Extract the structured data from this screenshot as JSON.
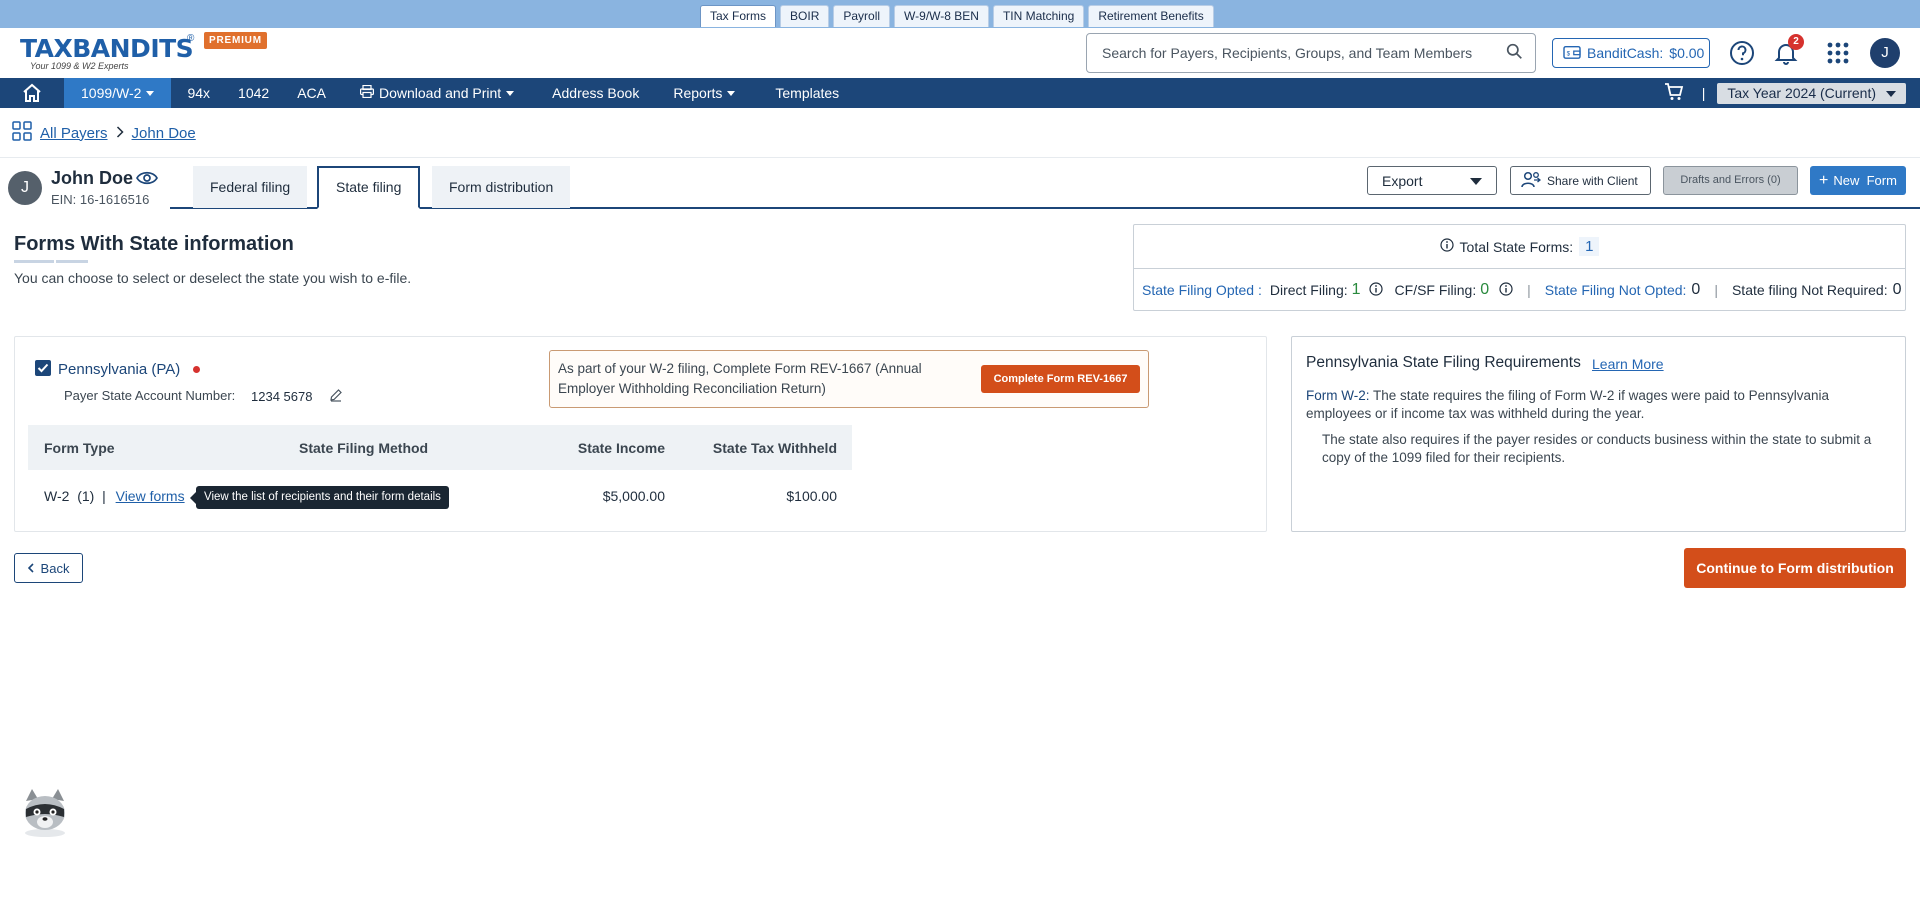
{
  "top_tabs": [
    "Tax Forms",
    "BOIR",
    "Payroll",
    "W-9/W-8 BEN",
    "TIN Matching",
    "Retirement Benefits"
  ],
  "brand": {
    "logo": "TAXBANDITS",
    "registered": "®",
    "tagline": "Your 1099 & W2 Experts",
    "badge": "PREMIUM",
    "accent_color": "#e0702d",
    "primary_color": "#1c4679"
  },
  "header": {
    "search_placeholder": "Search for Payers, Recipients, Groups, and Team Members",
    "bandit_cash_label": "BanditCash:",
    "bandit_cash_value": "$0.00",
    "notification_count": "2",
    "avatar_initial": "J"
  },
  "nav": {
    "items": [
      {
        "label": "1099/W-2",
        "active": true,
        "dropdown": true
      },
      {
        "label": "94x"
      },
      {
        "label": "1042"
      },
      {
        "label": "ACA"
      },
      {
        "label": "Download and Print",
        "dropdown": true,
        "icon": "printer-icon"
      },
      {
        "label": "Address Book"
      },
      {
        "label": "Reports",
        "dropdown": true
      },
      {
        "label": "Templates"
      }
    ],
    "tax_year": "Tax Year 2024 (Current)"
  },
  "breadcrumb": {
    "root": "All Payers",
    "current": "John Doe"
  },
  "payer": {
    "initial": "J",
    "name": "John Doe",
    "ein": "EIN: 16-1616516"
  },
  "filing_tabs": [
    {
      "label": "Federal filing"
    },
    {
      "label": "State filing",
      "active": true
    },
    {
      "label": "Form distribution"
    }
  ],
  "actions": {
    "export": "Export",
    "share": "Share with Client",
    "drafts": "Drafts and Errors (0)",
    "new_form": "New  Form"
  },
  "section": {
    "title": "Forms With State information",
    "subtitle": "You can choose to select or deselect the state you wish to e-file."
  },
  "totals": {
    "label": "Total State Forms:",
    "count": "1",
    "opted_label": "State Filing Opted :",
    "direct_label": "Direct Filing:",
    "direct_value": "1",
    "cfsf_label": "CF/SF Filing:",
    "cfsf_value": "0",
    "not_opted_label": "State Filing Not Opted:",
    "not_opted_value": "0",
    "not_required_label": "State filing Not Required:",
    "not_required_value": "0"
  },
  "state": {
    "name": "Pennsylvania (PA)",
    "checked": true,
    "account_label": "Payer State Account Number:",
    "account_value": "1234 5678",
    "notice": "As part of your W-2 filing, Complete Form REV-1667 (Annual Employer Withholding Reconciliation Return)",
    "notice_button": "Complete Form REV-1667",
    "table": {
      "headers": [
        "Form Type",
        "State Filing Method",
        "State Income",
        "State Tax Withheld"
      ],
      "rows": [
        {
          "form_type": "W-2  (1)  |",
          "link": "View forms",
          "method": "",
          "income": "$5,000.00",
          "withheld": "$100.00"
        }
      ]
    },
    "tooltip": "View the list of recipients and their form details"
  },
  "requirements": {
    "title": "Pennsylvania State Filing Requirements",
    "learn_more": "Learn More",
    "form_label": "Form W-2:",
    "text1": " The state requires the filing of Form W-2 if wages were paid to Pennsylvania employees or if income tax was withheld during the year.",
    "text2": "The state also requires if the payer resides or conducts business within the state to submit a copy of the 1099 filed for their recipients."
  },
  "buttons": {
    "back": "Back",
    "continue": "Continue to Form distribution"
  }
}
